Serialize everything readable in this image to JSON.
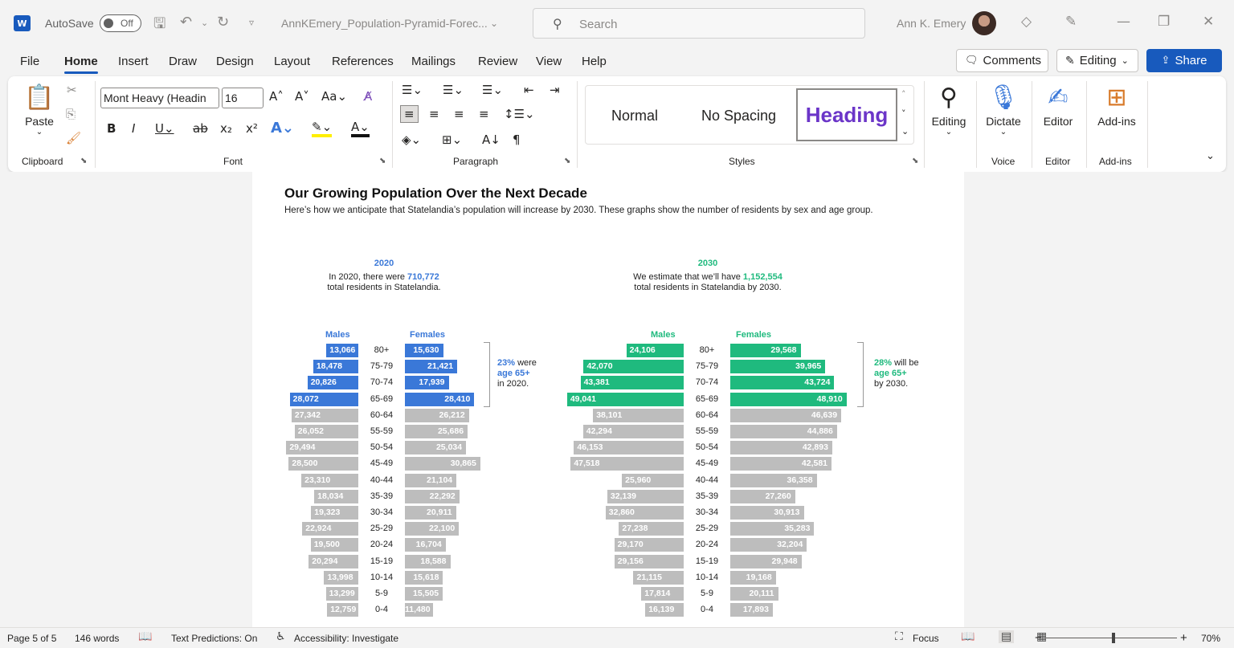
{
  "titlebar": {
    "autosave_label": "AutoSave",
    "autosave_state": "Off",
    "doc_title": "AnnKEmery_Population-Pyramid-Forec...",
    "search_placeholder": "Search",
    "user_name": "Ann K. Emery"
  },
  "menu": {
    "items": [
      "File",
      "Home",
      "Insert",
      "Draw",
      "Design",
      "Layout",
      "References",
      "Mailings",
      "Review",
      "View",
      "Help"
    ],
    "active": "Home",
    "comments_label": "Comments",
    "editing_label": "Editing",
    "share_label": "Share"
  },
  "ribbon": {
    "paste_label": "Paste",
    "font_name": "Mont Heavy (Headin",
    "font_size": "16",
    "styles": {
      "normal": "Normal",
      "no_spacing": "No Spacing",
      "heading": "Heading"
    },
    "editing_label": "Editing",
    "dictate_label": "Dictate",
    "editor_label": "Editor",
    "addins_label": "Add-ins",
    "groups": {
      "clipboard": "Clipboard",
      "font": "Font",
      "paragraph": "Paragraph",
      "styles": "Styles",
      "voice": "Voice",
      "editor": "Editor",
      "addins": "Add-ins"
    }
  },
  "document": {
    "heading": "Our Growing Population Over the Next Decade",
    "subheading": "Here’s how we anticipate that Statelandia’s population will increase by 2030. These graphs show the number of residents by sex and age group.",
    "y2020": {
      "year": "2020",
      "desc_pre": "In 2020, there were ",
      "desc_value": "710,772",
      "desc_post": "total residents in Statelandia.",
      "males_label": "Males",
      "females_label": "Females",
      "note_pct": "23%",
      "note_word": " were",
      "note_age": "age 65+",
      "note_tail": "in 2020."
    },
    "y2030": {
      "year": "2030",
      "desc_pre": "We estimate that we’ll have ",
      "desc_value": "1,152,554",
      "desc_post": "total residents in Statelandia by 2030.",
      "males_label": "Males",
      "females_label": "Females",
      "note_pct": "28%",
      "note_word": " will be",
      "note_age": "age 65+",
      "note_tail": "by 2030."
    }
  },
  "chart_data": [
    {
      "type": "bar",
      "categories": [
        "80+",
        "75-79",
        "70-74",
        "65-69",
        "60-64",
        "55-59",
        "50-54",
        "45-49",
        "40-44",
        "35-39",
        "30-34",
        "25-29",
        "20-24",
        "15-19",
        "10-14",
        "5-9",
        "0-4"
      ],
      "series": [
        {
          "name": "Males",
          "values": [
            13066,
            18478,
            20826,
            28072,
            27342,
            26052,
            29494,
            28500,
            23310,
            18034,
            19323,
            22924,
            19500,
            20294,
            13998,
            13299,
            12759
          ],
          "labels": [
            "13,066",
            "18,478",
            "20,826",
            "28,072",
            "27,342",
            "26,052",
            "29,494",
            "28,500",
            "23,310",
            "18,034",
            "19,323",
            "22,924",
            "19,500",
            "20,294",
            "13,998",
            "13,299",
            "12,759"
          ]
        },
        {
          "name": "Females",
          "values": [
            15630,
            21421,
            17939,
            28410,
            26212,
            25686,
            25034,
            30865,
            21104,
            22292,
            20911,
            22100,
            16704,
            18588,
            15618,
            15505,
            11480
          ],
          "labels": [
            "15,630",
            "21,421",
            "17,939",
            "28,410",
            "26,212",
            "25,686",
            "25,034",
            "30,865",
            "21,104",
            "22,292",
            "20,911",
            "22,100",
            "16,704",
            "18,588",
            "15,618",
            "15,505",
            "11,480"
          ]
        }
      ],
      "title": "2020",
      "highlight_color": "#3a78d8",
      "base_color": "#bdbdbd",
      "highlight_groups": [
        "80+",
        "75-79",
        "70-74",
        "65-69"
      ]
    },
    {
      "type": "bar",
      "categories": [
        "80+",
        "75-79",
        "70-74",
        "65-69",
        "60-64",
        "55-59",
        "50-54",
        "45-49",
        "40-44",
        "35-39",
        "30-34",
        "25-29",
        "20-24",
        "15-19",
        "10-14",
        "5-9",
        "0-4"
      ],
      "series": [
        {
          "name": "Males",
          "values": [
            24106,
            42070,
            43381,
            49041,
            38101,
            42294,
            46153,
            47518,
            25960,
            32139,
            32860,
            27238,
            29170,
            29156,
            21115,
            17814,
            16139
          ],
          "labels": [
            "24,106",
            "42,070",
            "43,381",
            "49,041",
            "38,101",
            "42,294",
            "46,153",
            "47,518",
            "25,960",
            "32,139",
            "32,860",
            "27,238",
            "29,170",
            "29,156",
            "21,115",
            "17,814",
            "16,139"
          ]
        },
        {
          "name": "Females",
          "values": [
            29568,
            39965,
            43724,
            48910,
            46639,
            44886,
            42893,
            42581,
            36358,
            27260,
            30913,
            35283,
            32204,
            29948,
            19168,
            20111,
            17893
          ],
          "labels": [
            "29,568",
            "39,965",
            "43,724",
            "48,910",
            "46,639",
            "44,886",
            "42,893",
            "42,581",
            "36,358",
            "27,260",
            "30,913",
            "35,283",
            "32,204",
            "29,948",
            "19,168",
            "20,111",
            "17,893"
          ]
        }
      ],
      "title": "2030",
      "highlight_color": "#1fba7e",
      "base_color": "#bdbdbd",
      "highlight_groups": [
        "80+",
        "75-79",
        "70-74",
        "65-69"
      ]
    }
  ],
  "statusbar": {
    "page": "Page 5 of 5",
    "words": "146 words",
    "predictions": "Text Predictions: On",
    "accessibility": "Accessibility: Investigate",
    "focus": "Focus",
    "zoom": "70%",
    "zoom_value": 70
  }
}
